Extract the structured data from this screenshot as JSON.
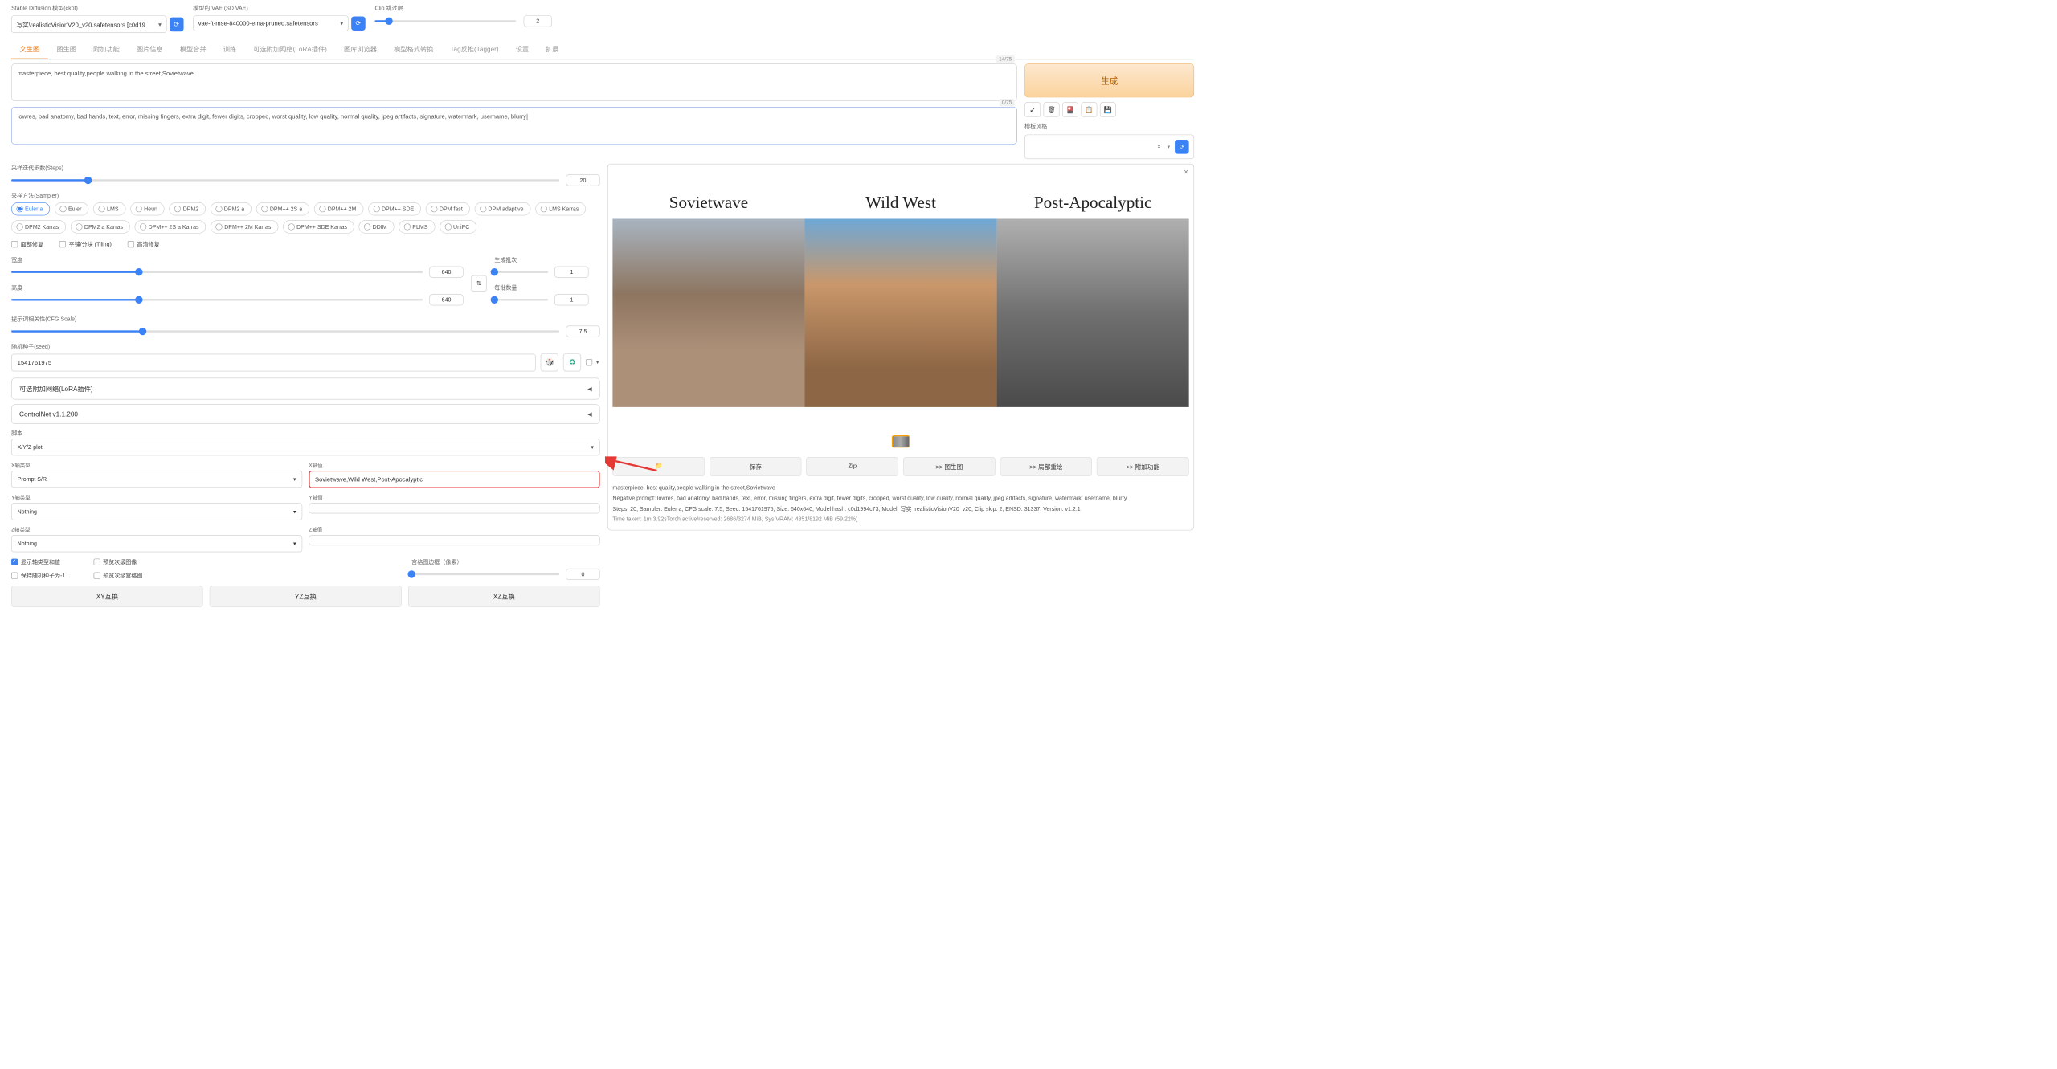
{
  "top": {
    "model_label": "Stable Diffusion 模型(ckpt)",
    "model_value": "写实\\realisticVisionV20_v20.safetensors [c0d19",
    "vae_label": "模型的 VAE (SD VAE)",
    "vae_value": "vae-ft-mse-840000-ema-pruned.safetensors",
    "clip_label": "Clip 跳过层",
    "clip_value": "2"
  },
  "tabs": [
    "文生图",
    "图生图",
    "附加功能",
    "图片信息",
    "模型合并",
    "训练",
    "可选附加网络(LoRA插件)",
    "图库浏览器",
    "模型格式转换",
    "Tag反推(Tagger)",
    "设置",
    "扩展"
  ],
  "active_tab": 0,
  "prompt": {
    "positive": "masterpiece, best quality,people walking in the street,Sovietwave",
    "positive_tokens": "14/75",
    "negative": "lowres, bad anatomy, bad hands, text, error, missing fingers, extra digit, fewer digits, cropped, worst quality, low quality, normal quality, jpeg artifacts, signature, watermark, username, blurry",
    "negative_tokens": "0/75"
  },
  "generate": "生成",
  "style_label": "模板风格",
  "style_x": "×",
  "steps": {
    "label": "采样迭代步数(Steps)",
    "value": "20",
    "fill": "14%"
  },
  "sampler_label": "采样方法(Sampler)",
  "samplers": [
    "Euler a",
    "Euler",
    "LMS",
    "Heun",
    "DPM2",
    "DPM2 a",
    "DPM++ 2S a",
    "DPM++ 2M",
    "DPM++ SDE",
    "DPM fast",
    "DPM adaptive",
    "LMS Karras",
    "DPM2 Karras",
    "DPM2 a Karras",
    "DPM++ 2S a Karras",
    "DPM++ 2M Karras",
    "DPM++ SDE Karras",
    "DDIM",
    "PLMS",
    "UniPC"
  ],
  "sampler_selected": 0,
  "checks": {
    "face": "面部修复",
    "tile": "平铺/分块 (Tiling)",
    "hires": "高清修复"
  },
  "width": {
    "label": "宽度",
    "value": "640",
    "fill": "31%"
  },
  "height": {
    "label": "高度",
    "value": "640",
    "fill": "31%"
  },
  "batch_count": {
    "label": "生成批次",
    "value": "1"
  },
  "batch_size": {
    "label": "每批数量",
    "value": "1"
  },
  "cfg": {
    "label": "提示词相关性(CFG Scale)",
    "value": "7.5",
    "fill": "24%"
  },
  "seed": {
    "label": "随机种子(seed)",
    "value": "1541761975",
    "dice": "🎲",
    "recycle": "♻"
  },
  "accordions": {
    "lora": "可选附加网络(LoRA插件)",
    "controlnet": "ControlNet v1.1.200"
  },
  "script": {
    "label": "脚本",
    "value": "X/Y/Z plot"
  },
  "xyz": {
    "x_type_label": "X轴类型",
    "x_type": "Prompt S/R",
    "x_val_label": "X轴值",
    "x_val": "Sovietwave,Wild West,Post-Apocalyptic",
    "y_type_label": "Y轴类型",
    "y_type": "Nothing",
    "y_val_label": "Y轴值",
    "y_val": "",
    "z_type_label": "Z轴类型",
    "z_type": "Nothing",
    "z_val_label": "Z轴值",
    "z_val": ""
  },
  "bottom_checks": {
    "show_axis": "显示轴类型和值",
    "sub_img": "预览次级图像",
    "keep_seed": "保持随机种子为-1",
    "sub_grid": "预览次级宫格图",
    "margin_label": "宫格图边框（像素）",
    "margin_value": "0"
  },
  "swap_btns": [
    "XY互换",
    "YZ互换",
    "XZ互换"
  ],
  "output": {
    "titles": [
      "Sovietwave",
      "Wild West",
      "Post-Apocalyptic"
    ],
    "actions_icon": "📁",
    "actions": [
      "保存",
      "Zip",
      ">> 图生图",
      ">> 局部重绘",
      ">> 附加功能"
    ],
    "text_prompt": "masterpiece, best quality,people walking in the street,Sovietwave",
    "text_neg": "Negative prompt: lowres, bad anatomy, bad hands, text, error, missing fingers, extra digit, fewer digits, cropped, worst quality, low quality, normal quality, jpeg artifacts, signature, watermark, username, blurry",
    "text_params": "Steps: 20, Sampler: Euler a, CFG scale: 7.5, Seed: 1541761975, Size: 640x640, Model hash: c0d1994c73, Model: 写实_realisticVisionV20_v20, Clip skip: 2, ENSD: 31337, Version: v1.2.1",
    "text_time": "Time taken: 1m 3.92sTorch active/reserved: 2686/3274 MiB, Sys VRAM: 4851/8192 MiB (59.22%)"
  }
}
